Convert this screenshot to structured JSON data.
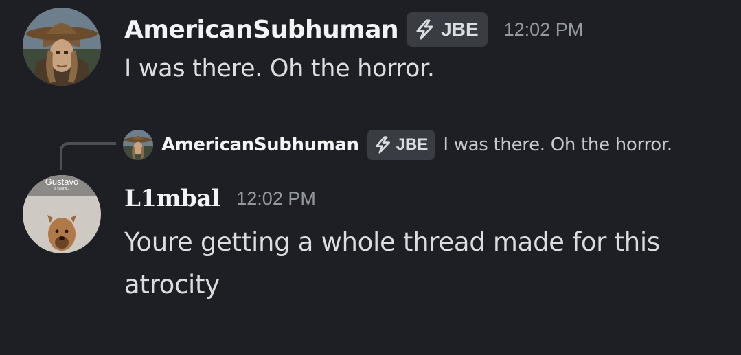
{
  "messages": [
    {
      "username": "AmericanSubhuman",
      "tag": {
        "icon": "lightning-icon",
        "label": "JBE"
      },
      "timestamp": "12:02 PM",
      "content": "I was there. Oh the horror.",
      "avatar": {
        "description_icon": "cowboy-hat-avatar"
      }
    },
    {
      "reply_to": {
        "username": "AmericanSubhuman",
        "tag": {
          "icon": "lightning-icon",
          "label": "JBE"
        },
        "content": "I was there. Oh the horror."
      },
      "username": "L1mbal",
      "timestamp": "12:02 PM",
      "content": "Youre getting a whole thread made for this atrocity",
      "avatar": {
        "caption": "Gustavo",
        "subcaption": "is calling..."
      }
    }
  ],
  "colors": {
    "background": "#1e1f24",
    "username": "#f2f3f5",
    "text": "#dbdee1",
    "timestamp": "#9499a1",
    "tag_bg": "#3a3c43",
    "reply_spine": "#4e5058"
  }
}
